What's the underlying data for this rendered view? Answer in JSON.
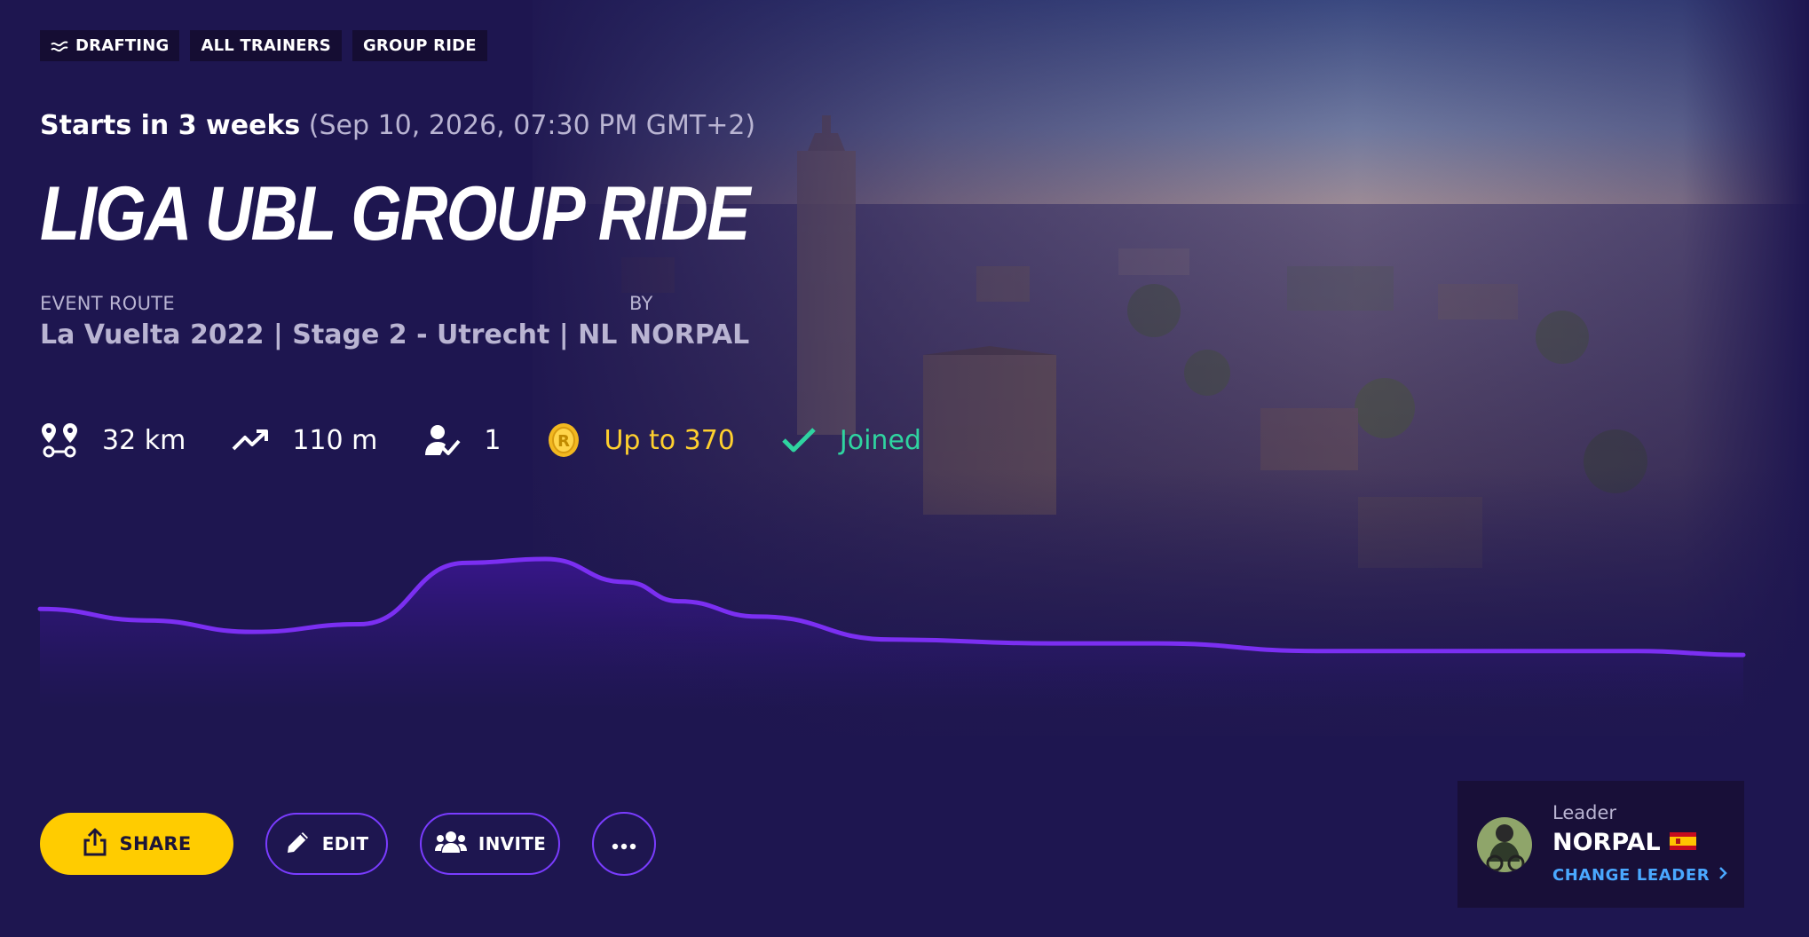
{
  "tags": [
    {
      "label": "DRAFTING",
      "icon": "wind-icon"
    },
    {
      "label": "ALL TRAINERS"
    },
    {
      "label": "GROUP RIDE"
    }
  ],
  "event": {
    "starts_in": "Starts in 3 weeks",
    "date_time": "(Sep 10, 2026, 07:30 PM GMT+2)",
    "title": "LIGA UBL GROUP RIDE",
    "route_label": "EVENT ROUTE",
    "route_value": "La Vuelta 2022 | Stage 2 - Utrecht | NL",
    "by_label": "BY",
    "by_value": "NORPAL"
  },
  "stats": {
    "distance": "32 km",
    "elevation": "110 m",
    "participants": "1",
    "coins": "Up to 370",
    "status": "Joined"
  },
  "actions": {
    "share": "SHARE",
    "edit": "EDIT",
    "invite": "INVITE",
    "more": "more-icon"
  },
  "leader": {
    "label": "Leader",
    "name": "NORPAL",
    "change": "CHANGE LEADER"
  },
  "colors": {
    "background": "#1e1650",
    "accent_purple": "#7a3cff",
    "share_yellow": "#ffcc00",
    "coins_yellow": "#ffd02e",
    "joined_green": "#2fd4a0",
    "link_blue": "#4aa8ff"
  },
  "elevation_profile": {
    "distance": [
      0,
      2,
      4,
      6,
      8,
      9.5,
      11,
      12,
      13.5,
      16,
      19,
      21,
      24,
      27.5,
      30,
      32
    ],
    "altitude": [
      24,
      21,
      18,
      20,
      36,
      37,
      31,
      26,
      22,
      16,
      15,
      15,
      13,
      13,
      13,
      12
    ]
  }
}
